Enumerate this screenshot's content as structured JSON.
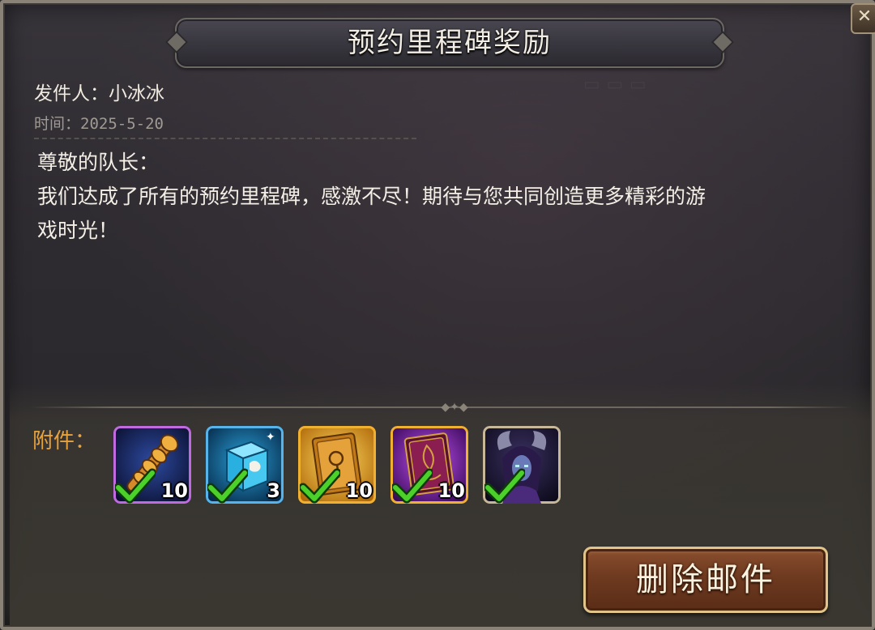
{
  "mail": {
    "title": "预约里程碑奖励",
    "sender_label": "发件人：小冰冰",
    "time_label": "时间：2025-5-20",
    "body": "尊敬的队长：\n我们达成了所有的预约里程碑，感激不尽！期待与您共同创造更多精彩的游\n戏时光！"
  },
  "attachments": {
    "label": "附件：",
    "items": [
      {
        "icon": "golden-staff-icon",
        "frame_color": "#b85ad8",
        "quantity": "10",
        "claimed": true
      },
      {
        "icon": "ice-cube-icon",
        "frame_color": "#4aa8e0",
        "quantity": "3",
        "claimed": true
      },
      {
        "icon": "gold-card-icon",
        "frame_color": "#e8a82a",
        "quantity": "10",
        "claimed": true
      },
      {
        "icon": "purple-card-icon",
        "frame_color": "#e8a82a",
        "quantity": "10",
        "claimed": true
      },
      {
        "icon": "hero-portrait-icon",
        "frame_color": "#c8b89a",
        "quantity": "",
        "claimed": true
      }
    ]
  },
  "actions": {
    "delete_label": "删除邮件"
  },
  "colors": {
    "accent_orange": "#e8a23a",
    "check_green": "#4cd02a",
    "button_brown": "#6e3a20"
  }
}
